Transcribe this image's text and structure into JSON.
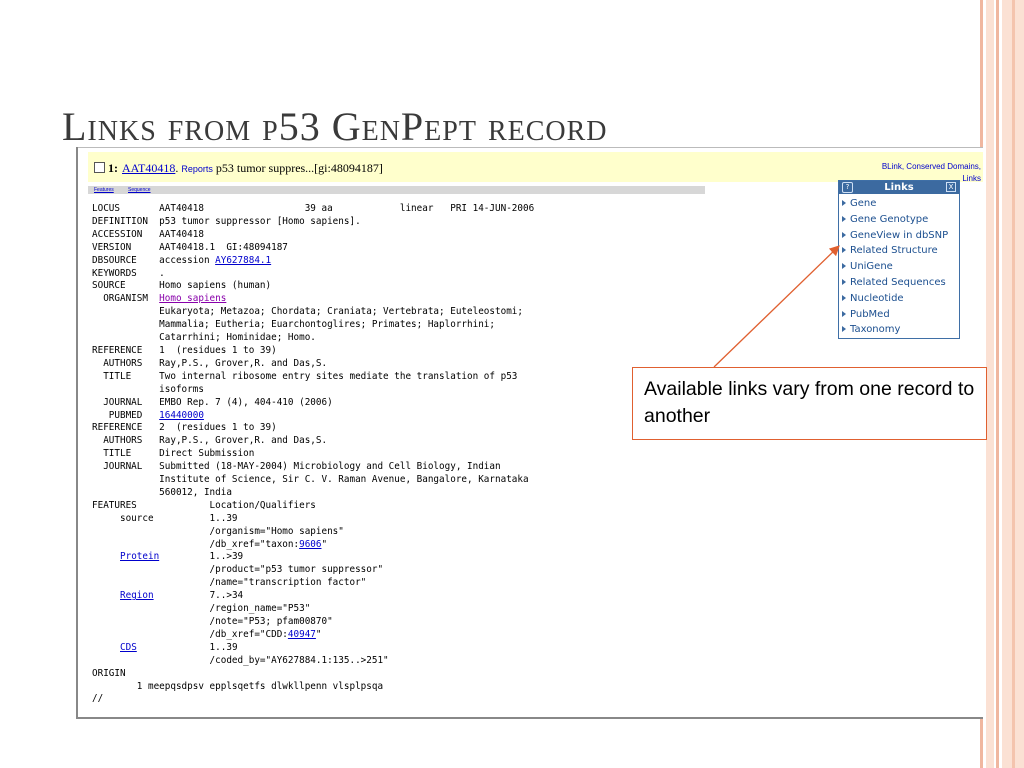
{
  "slide": {
    "title": "Links from p53 GenPept record"
  },
  "record_header": {
    "number": "1:",
    "accession_link": "AAT40418",
    "reports": "Reports",
    "description": "p53 tumor suppres...[gi:48094187]",
    "right_links_1": "BLink, Conserved Domains,",
    "right_links_2": "Links"
  },
  "tabs": {
    "features": "Features",
    "sequence": "Sequence"
  },
  "record": {
    "locus": "LOCUS       AAT40418                  39 aa            linear   PRI 14-JUN-2006",
    "definition": "DEFINITION  p53 tumor suppressor [Homo sapiens].",
    "accession": "ACCESSION   AAT40418",
    "version": "VERSION     AAT40418.1  GI:48094187",
    "dbsource_prefix": "DBSOURCE    accession ",
    "dbsource_link": "AY627884.1",
    "keywords": "KEYWORDS    .",
    "source": "SOURCE      Homo sapiens (human)",
    "organism_prefix": "  ORGANISM  ",
    "organism_link": "Homo sapiens",
    "taxonomy_1": "            Eukaryota; Metazoa; Chordata; Craniata; Vertebrata; Euteleostomi;",
    "taxonomy_2": "            Mammalia; Eutheria; Euarchontoglires; Primates; Haplorrhini;",
    "taxonomy_3": "            Catarrhini; Hominidae; Homo.",
    "ref1": "REFERENCE   1  (residues 1 to 39)",
    "ref1_authors": "  AUTHORS   Ray,P.S., Grover,R. and Das,S.",
    "ref1_title_1": "  TITLE     Two internal ribosome entry sites mediate the translation of p53",
    "ref1_title_2": "            isoforms",
    "ref1_journal": "  JOURNAL   EMBO Rep. 7 (4), 404-410 (2006)",
    "ref1_pubmed_prefix": "   PUBMED   ",
    "ref1_pubmed_link": "16440000",
    "ref2": "REFERENCE   2  (residues 1 to 39)",
    "ref2_authors": "  AUTHORS   Ray,P.S., Grover,R. and Das,S.",
    "ref2_title": "  TITLE     Direct Submission",
    "ref2_journal_1": "  JOURNAL   Submitted (18-MAY-2004) Microbiology and Cell Biology, Indian",
    "ref2_journal_2": "            Institute of Science, Sir C. V. Raman Avenue, Bangalore, Karnataka",
    "ref2_journal_3": "            560012, India",
    "features": "FEATURES             Location/Qualifiers",
    "source_feat": "     source          1..39",
    "source_org": "                     /organism=\"Homo sapiens\"",
    "source_xref_prefix": "                     /db_xref=\"taxon:",
    "source_xref_link": "9606",
    "quote": "\"",
    "feat_indent": "     ",
    "protein_link": "Protein",
    "protein_loc": "         1..>39",
    "protein_product": "                     /product=\"p53 tumor suppressor\"",
    "protein_name": "                     /name=\"transcription factor\"",
    "region_link": "Region",
    "region_loc": "          7..>34",
    "region_name": "                     /region_name=\"P53\"",
    "region_note": "                     /note=\"P53; pfam00870\"",
    "region_xref_prefix": "                     /db_xref=\"CDD:",
    "region_xref_link": "40947",
    "cds_link": "CDS",
    "cds_loc": "             1..39",
    "cds_coded": "                     /coded_by=\"AY627884.1:135..>251\"",
    "origin": "ORIGIN",
    "seq": "        1 meepqsdpsv epplsqetfs dlwkllpenn vlsplpsqa",
    "end": "//"
  },
  "links_panel": {
    "title": "Links",
    "help": "?",
    "close": "X",
    "items": [
      "Gene",
      "Gene Genotype",
      "GeneView in dbSNP",
      "Related Structure",
      "UniGene",
      "Related Sequences",
      "Nucleotide",
      "PubMed",
      "Taxonomy"
    ]
  },
  "callout": {
    "text": "Available links vary from one record to another"
  },
  "colors": {
    "link": "#0000cc",
    "panel_header": "#3c6aa0",
    "callout_border": "#e06030",
    "header_bg": "#ffffcc"
  }
}
